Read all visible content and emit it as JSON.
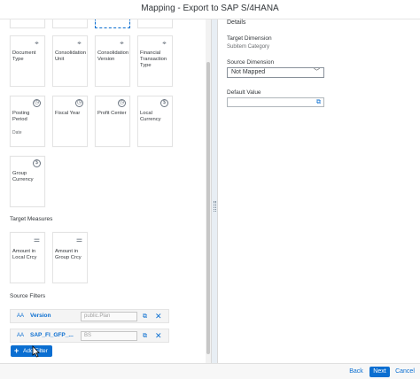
{
  "window": {
    "title": "Mapping - Export to SAP S/4HANA"
  },
  "dimension_cards": [
    {
      "label": "Document Type",
      "icon": "hierarchy-icon",
      "sub": ""
    },
    {
      "label": "Consolidation Unit",
      "icon": "hierarchy-icon",
      "sub": ""
    },
    {
      "label": "Consolidation Version",
      "icon": "hierarchy-icon",
      "sub": ""
    },
    {
      "label": "Financial Transaction Type",
      "icon": "hierarchy-icon",
      "sub": ""
    },
    {
      "label": "Posting Period",
      "icon": "clock-icon",
      "sub": "Date"
    },
    {
      "label": "Fiscal Year",
      "icon": "clock-icon",
      "sub": ""
    },
    {
      "label": "Profit Center",
      "icon": "clock-icon",
      "sub": ""
    },
    {
      "label": "Local Currency",
      "icon": "dollar-icon",
      "sub": ""
    },
    {
      "label": "Group Currency",
      "icon": "dollar-icon",
      "sub": ""
    }
  ],
  "target_measures": {
    "title": "Target Measures",
    "cards": [
      {
        "label": "Amount in Local Crcy",
        "icon": "measure-icon"
      },
      {
        "label": "Amount in Group Crcy",
        "icon": "measure-icon"
      }
    ]
  },
  "source_filters": {
    "title": "Source Filters",
    "items": [
      {
        "type_icon": "AA",
        "name": "Version",
        "value": "public.Plan"
      },
      {
        "type_icon": "AA",
        "name": "SAP_FI_GFP_...",
        "value": "BS"
      }
    ],
    "add_label": "Add Filter"
  },
  "details": {
    "title": "Details",
    "target_dimension_label": "Target Dimension",
    "target_dimension_value": "Subitem Category",
    "source_dimension_label": "Source Dimension",
    "source_dimension_value": "Not Mapped",
    "default_value_label": "Default Value",
    "default_value": ""
  },
  "footer": {
    "back": "Back",
    "next": "Next",
    "cancel": "Cancel"
  },
  "colors": {
    "accent": "#0a6ed1"
  }
}
